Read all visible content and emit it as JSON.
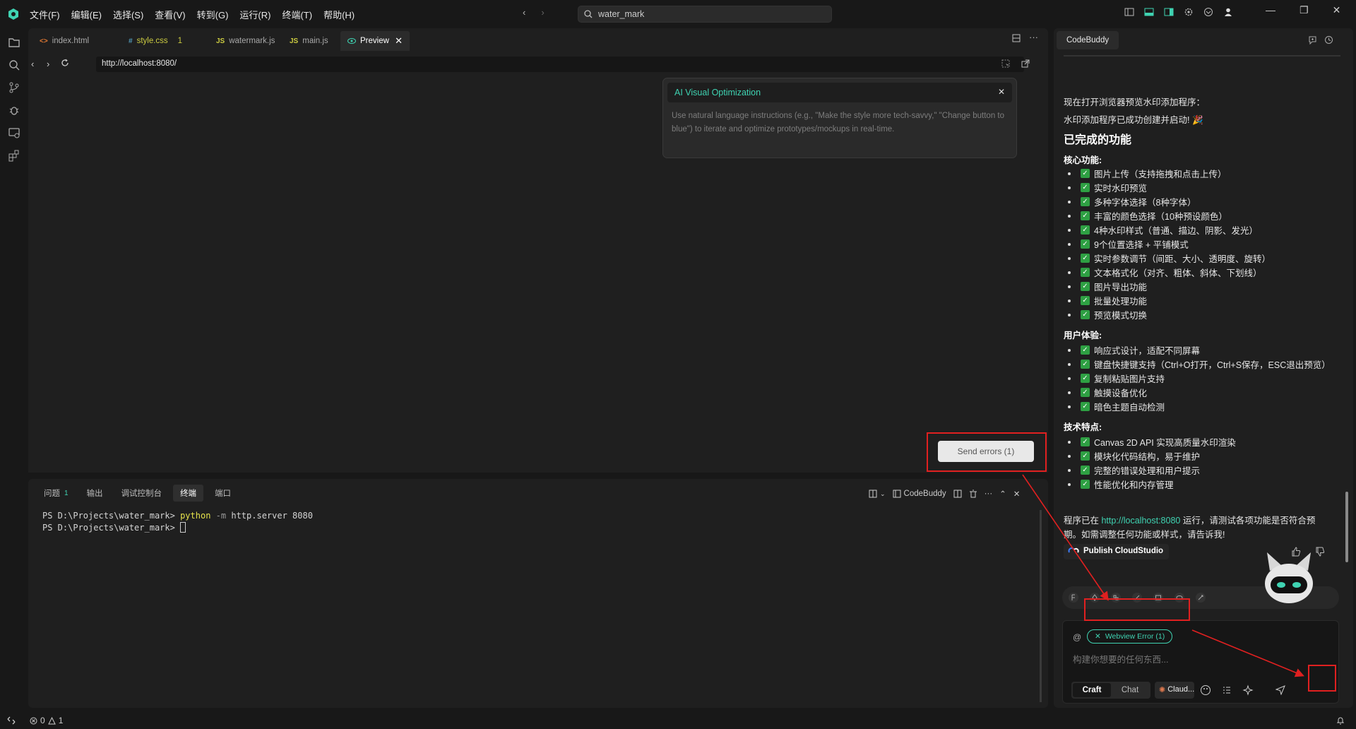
{
  "menu": [
    "文件(F)",
    "编辑(E)",
    "选择(S)",
    "查看(V)",
    "转到(G)",
    "运行(R)",
    "终端(T)",
    "帮助(H)"
  ],
  "search": {
    "value": "water_mark"
  },
  "tabs": [
    {
      "icon": "<>",
      "label": "index.html",
      "color": "#e37933"
    },
    {
      "icon": "#",
      "label": "style.css",
      "badge": "1",
      "color": "#519aba"
    },
    {
      "icon": "JS",
      "label": "watermark.js",
      "color": "#cbcb41"
    },
    {
      "icon": "JS",
      "label": "main.js",
      "color": "#cbcb41"
    },
    {
      "icon": "eye",
      "label": "Preview",
      "color": "#3fd3b2"
    }
  ],
  "url": "http://localhost:8080/",
  "ai_popup": {
    "title": "AI Visual Optimization",
    "description": "Use natural language instructions (e.g., \"Make the style more tech-savvy,\" \"Change button to blue\") to iterate and optimize prototypes/mockups in real-time."
  },
  "send_errors": "Send errors (1)",
  "panel": {
    "tabs": [
      {
        "label": "问题",
        "badge": "1"
      },
      {
        "label": "输出"
      },
      {
        "label": "调试控制台"
      },
      {
        "label": "终端"
      },
      {
        "label": "端口"
      }
    ],
    "codebuddy_label": "CodeBuddy",
    "terminal": {
      "prompt": "PS D:\\Projects\\water_mark>",
      "cmd": "python",
      "flag": "-m",
      "args": "http.server 8080"
    }
  },
  "status": {
    "errors": "0",
    "warnings": "1"
  },
  "chat": {
    "tab_label": "CodeBuddy",
    "intro1": "现在打开浏览器预览水印添加程序：",
    "intro2": "水印添加程序已成功创建并启动! 🎉",
    "heading": "已完成的功能",
    "sections": [
      {
        "title": "核心功能:",
        "items": [
          "图片上传（支持拖拽和点击上传）",
          "实时水印预览",
          "多种字体选择（8种字体）",
          "丰富的颜色选择（10种预设颜色）",
          "4种水印样式（普通、描边、阴影、发光）",
          "9个位置选择 + 平铺模式",
          "实时参数调节（间距、大小、透明度、旋转）",
          "文本格式化（对齐、粗体、斜体、下划线）",
          "图片导出功能",
          "批量处理功能",
          "预览模式切换"
        ]
      },
      {
        "title": "用户体验:",
        "items": [
          "响应式设计，适配不同屏幕",
          "键盘快捷键支持（Ctrl+O打开，Ctrl+S保存，ESC退出预览）",
          "复制粘贴图片支持",
          "触摸设备优化",
          "暗色主题自动检测"
        ]
      },
      {
        "title": "技术特点:",
        "items": [
          "Canvas 2D API 实现高质量水印渲染",
          "模块化代码结构，易于维护",
          "完整的错误处理和用户提示",
          "性能优化和内存管理"
        ]
      }
    ],
    "outro_pre": "程序已在 ",
    "outro_link": "http://localhost:8080",
    "outro_post": " 运行，请测试各项功能是否符合预",
    "outro_line2": "期。如需调整任何功能或样式，请告诉我!",
    "publish_label": "Publish CloudStudio",
    "chip_label": "Webview Error (1)",
    "placeholder": "构建你想要的任何东西...",
    "mode_craft": "Craft",
    "mode_chat": "Chat",
    "model_label": "Claud..."
  },
  "colors": {
    "accent": "#3fd3b2",
    "highlight": "#e02020",
    "check": "#2ea043"
  }
}
